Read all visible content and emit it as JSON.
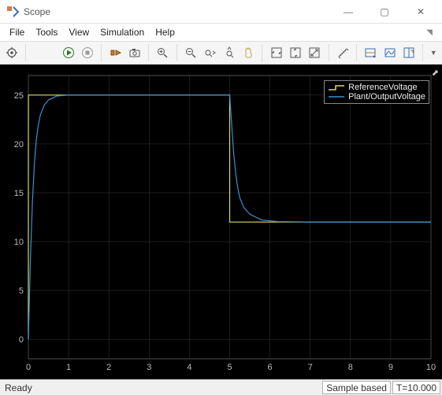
{
  "window": {
    "title": "Scope",
    "min_icon": "—",
    "max_icon": "▢",
    "close_icon": "✕"
  },
  "menubar": [
    "File",
    "Tools",
    "View",
    "Simulation",
    "Help"
  ],
  "toolbar_icons": {
    "settings": "gear",
    "run": "run",
    "stop": "stop",
    "step": "step",
    "snapshot": "camera",
    "zoom_in": "zoom+",
    "zoom_out": "zoom-",
    "zoom_xy": "zoom<>",
    "zoom_y": "zoomY",
    "pan": "hand",
    "fit_x": "fitX",
    "fit_y": "fitY",
    "fit_all": "fitAll",
    "measure": "meas",
    "cursor": "cursor",
    "peaks": "peaks",
    "float": "float",
    "dropdown": "▼"
  },
  "status": {
    "ready": "Ready",
    "sample": "Sample based",
    "time": "T=10.000"
  },
  "legend": [
    {
      "name": "ReferenceVoltage",
      "color": "#d9d96a"
    },
    {
      "name": "Plant/OutputVoltage",
      "color": "#3b8fd4"
    }
  ],
  "chart_data": {
    "type": "line",
    "title": "",
    "xlabel": "",
    "ylabel": "",
    "xlim": [
      0,
      10
    ],
    "ylim": [
      -2,
      27
    ],
    "xticks": [
      0,
      1,
      2,
      3,
      4,
      5,
      6,
      7,
      8,
      9,
      10
    ],
    "yticks": [
      0,
      5,
      10,
      15,
      20,
      25
    ],
    "series": [
      {
        "name": "ReferenceVoltage",
        "color": "#d9d96a",
        "x": [
          0,
          0.001,
          5,
          5.001,
          10
        ],
        "y": [
          0,
          25,
          25,
          12,
          12
        ]
      },
      {
        "name": "Plant/OutputVoltage",
        "color": "#3b8fd4",
        "x": [
          0,
          0.05,
          0.1,
          0.15,
          0.2,
          0.25,
          0.3,
          0.4,
          0.5,
          0.7,
          1.0,
          2.0,
          5.0,
          5.05,
          5.1,
          5.15,
          5.2,
          5.25,
          5.35,
          5.5,
          5.8,
          6.2,
          7.0,
          10.0
        ],
        "y": [
          0,
          8,
          14,
          18,
          20.5,
          22,
          23,
          24,
          24.5,
          24.9,
          25,
          25,
          25,
          22,
          19,
          17,
          15.5,
          14.5,
          13.5,
          12.8,
          12.2,
          12.05,
          12,
          12
        ]
      }
    ]
  }
}
